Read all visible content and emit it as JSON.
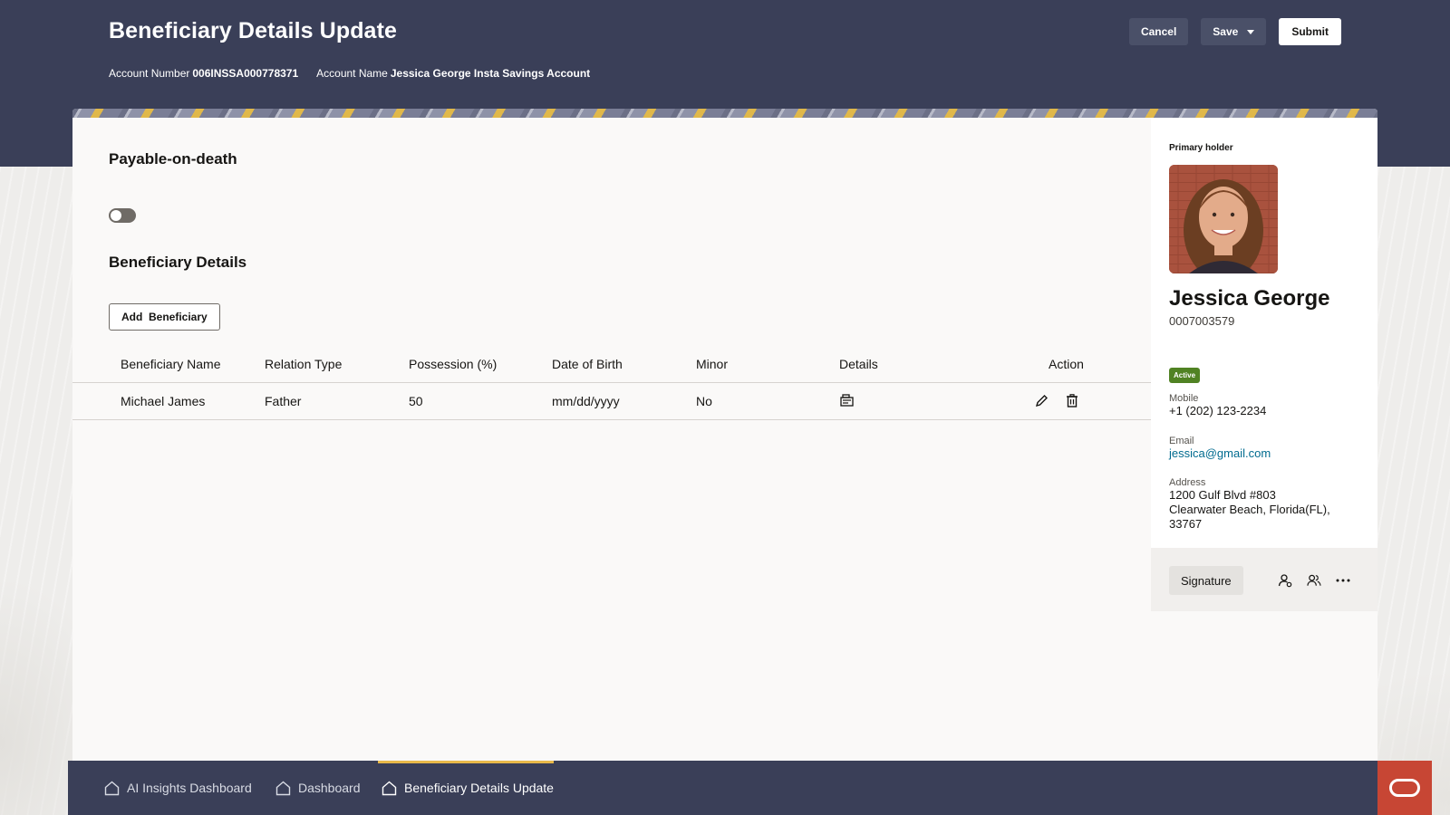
{
  "header": {
    "title": "Beneficiary Details Update",
    "account_number_label": "Account Number",
    "account_number": "006INSSA000778371",
    "account_name_label": "Account Name",
    "account_name": "Jessica George Insta Savings Account",
    "actions": {
      "cancel": "Cancel",
      "save": "Save",
      "submit": "Submit"
    }
  },
  "main": {
    "pod_title": "Payable-on-death",
    "pod_toggle_on": false,
    "beneficiary_title": "Beneficiary Details",
    "add_button": "Add  Beneficiary",
    "table": {
      "columns": [
        "Beneficiary Name",
        "Relation Type",
        "Possession (%)",
        "Date of Birth",
        "Minor",
        "Details",
        "Action"
      ],
      "rows": [
        {
          "name": "Michael James",
          "relation": "Father",
          "possession": "50",
          "dob": "mm/dd/yyyy",
          "minor": "No",
          "details_icon": "details-icon",
          "action_icons": [
            "edit-icon",
            "delete-icon"
          ]
        }
      ]
    }
  },
  "sidebar": {
    "label": "Primary holder",
    "name": "Jessica George",
    "customer_id": "0007003579",
    "status": "Active",
    "mobile_label": "Mobile",
    "mobile": "+1 (202) 123-2234",
    "email_label": "Email",
    "email": "jessica@gmail.com",
    "address_label": "Address",
    "address_line1": "1200 Gulf Blvd #803",
    "address_line2": "Clearwater Beach, Florida(FL),",
    "address_line3": "33767",
    "signature_button": "Signature",
    "icons": [
      "person-icon",
      "people-icon",
      "more-icon"
    ]
  },
  "bottom_tabs": [
    {
      "label": "AI Insights Dashboard",
      "active": false
    },
    {
      "label": "Dashboard",
      "active": false
    },
    {
      "label": "Beneficiary Details Update",
      "active": true
    }
  ],
  "colors": {
    "header_bg": "#3a3f58",
    "accent_tab": "#e8b94a",
    "status_active": "#508223",
    "brand": "#c74634",
    "link": "#006b8f"
  }
}
